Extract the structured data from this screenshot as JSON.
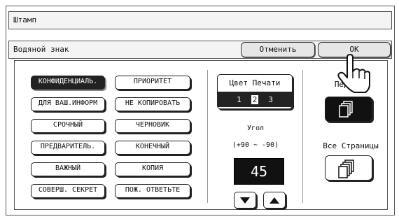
{
  "title": "Штамп",
  "subtitle": "Водяной знак",
  "buttons": {
    "cancel": "Отменить",
    "ok": "ОК"
  },
  "stamps": {
    "left": [
      "КОНФИДЕНЦИАЛЬ.",
      "ДЛЯ ВАШ.ИНФОРМ",
      "СРОЧНЫЙ",
      "ПРЕДВАРИТЕЛЬ.",
      "ВАЖНЫЙ",
      "СОВЕРШ. СЕКРЕТ"
    ],
    "right": [
      "ПРИОРИТЕТ",
      "НЕ КОПИРОВАТЬ",
      "ЧЕРНОВИК",
      "КОНЕЧНЫЙ",
      "КОПИЯ",
      "ПОЖ. ОТВЕТЬТЕ"
    ]
  },
  "color": {
    "title": "Цвет Печати",
    "d1": "1",
    "d2": "2",
    "d3": "3"
  },
  "angle": {
    "label": "Угол",
    "range": "(+90 ~ -90)",
    "value": "45"
  },
  "pages": {
    "first": "Перв      иц",
    "all": "Все Страницы"
  }
}
